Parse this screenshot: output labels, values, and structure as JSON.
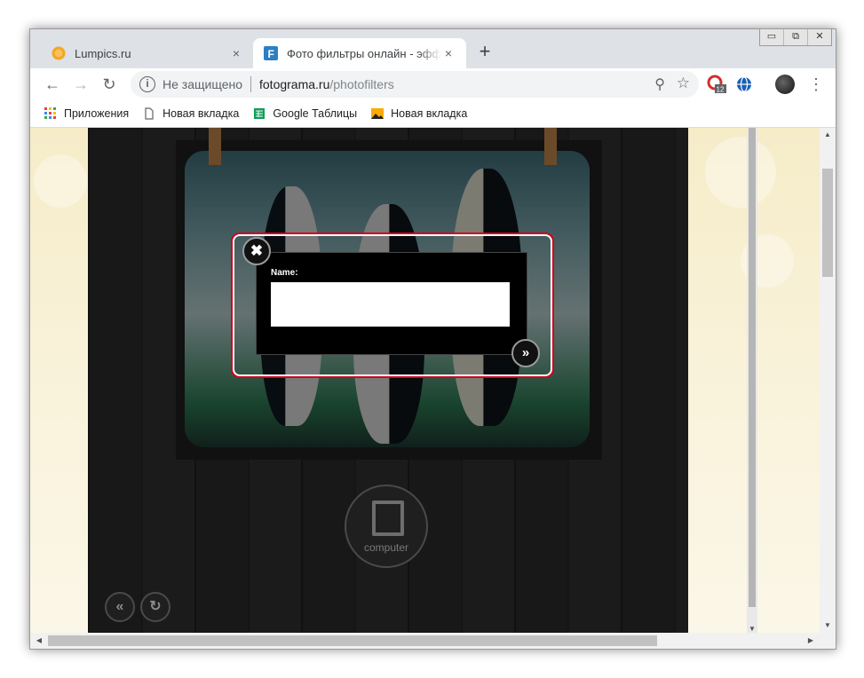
{
  "tabs": [
    {
      "title": "Lumpics.ru",
      "close": "×",
      "favicon": "orange-circle-icon"
    },
    {
      "title": "Фото фильтры онлайн - эффекты",
      "close": "×",
      "favicon": "fotograma-f-icon"
    }
  ],
  "new_tab_label": "+",
  "window_controls": {
    "minimize": "▭",
    "restore": "⧉",
    "close": "✕"
  },
  "nav": {
    "back": "←",
    "forward": "→",
    "reload": "↻"
  },
  "address": {
    "security_icon": "ⓘ",
    "security_text": "Не защищено",
    "host": "fotograma.ru",
    "path": "/photofilters",
    "zoom_icon": "⚲",
    "star_icon": "☆"
  },
  "extensions": {
    "badge_count": "12"
  },
  "menu_icon": "⋮",
  "bookmarks": [
    {
      "label": "Приложения",
      "icon": "apps-grid-icon"
    },
    {
      "label": "Новая вкладка",
      "icon": "page-icon"
    },
    {
      "label": "Google Таблицы",
      "icon": "sheets-icon"
    },
    {
      "label": "Новая вкладка",
      "icon": "image-icon"
    }
  ],
  "dialog": {
    "name_label": "Name:",
    "name_value": "",
    "close_icon": "✖",
    "next_icon": "»"
  },
  "upload": {
    "label": "computer"
  },
  "controls": {
    "back_icon": "«",
    "reset_icon": "↻"
  },
  "colors": {
    "highlight": "#d0011b",
    "dialog_bg": "#000000"
  }
}
